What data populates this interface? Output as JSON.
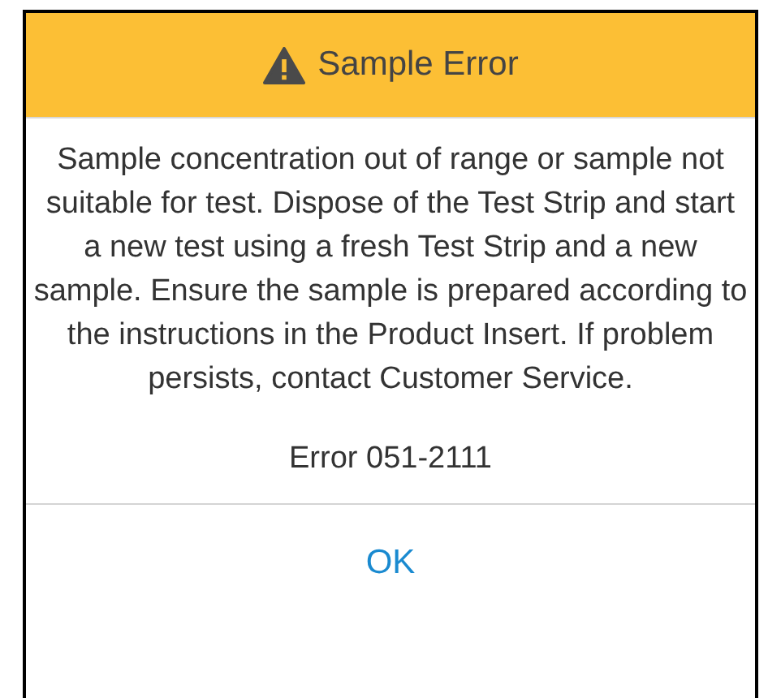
{
  "dialog": {
    "title": "Sample Error",
    "message": "Sample concentration out of range or sample not suitable for test. Dispose of the Test Strip and start a new test using a fresh Test Strip and a new sample. Ensure the sample is prepared according to the instructions in the Product Insert. If problem persists, contact Customer Service.",
    "error_code": "Error 051-2111",
    "buttons": [
      "OK"
    ]
  }
}
